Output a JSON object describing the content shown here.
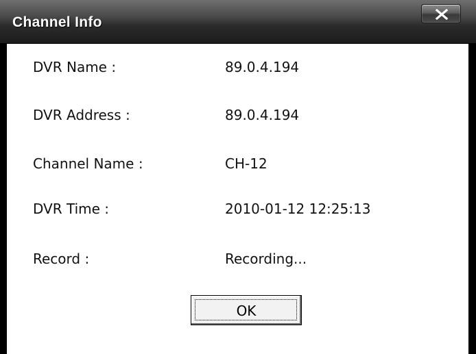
{
  "window": {
    "title": "Channel Info",
    "close_icon": "close-icon"
  },
  "fields": [
    {
      "label": "DVR Name :",
      "value": "89.0.4.194"
    },
    {
      "label": "DVR Address :",
      "value": "89.0.4.194"
    },
    {
      "label": "Channel Name :",
      "value": "CH-12"
    },
    {
      "label": "DVR Time :",
      "value": "2010-01-12 12:25:13"
    },
    {
      "label": "Record :",
      "value": "Recording..."
    }
  ],
  "buttons": {
    "ok_label": "OK"
  },
  "colors": {
    "titlebar": "#2b2b2b",
    "frame": "#000000",
    "client_bg": "#ffffff"
  }
}
